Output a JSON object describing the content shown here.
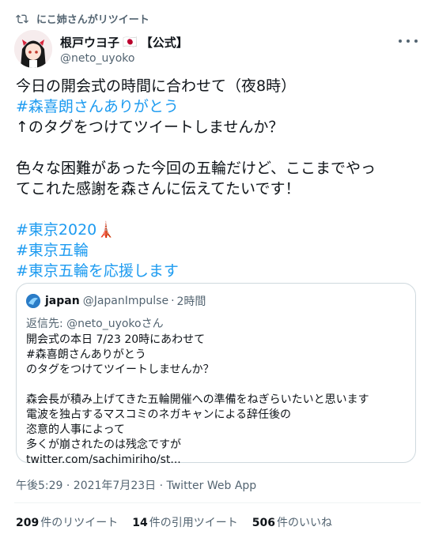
{
  "retweet_banner": "にこ姉さんがリツイート",
  "author": {
    "name": "根戸ウヨ子",
    "flag": "🇯🇵",
    "badge": "【公式】",
    "handle": "@neto_uyoko"
  },
  "tweet": {
    "line1": "今日の開会式の時間に合わせて（夜8時）",
    "line2_hashtag": "#森喜朗さんありがとう",
    "line3": "↑のタグをつけてツイートしませんか？",
    "line4": "色々な困難があった今回の五輪だけど、ここまでやっ",
    "line5": "てこれた感謝を森さんに伝えてたいです！",
    "hashtag1": "#東京2020",
    "hashtag1_emoji": "🗼",
    "hashtag2": "#東京五輪",
    "hashtag3": "#東京五輪を応援します"
  },
  "quote": {
    "name": "japan",
    "handle": "@JapanImpulse",
    "sep": "·",
    "time": "2時間",
    "reply_to": "返信先: @neto_uyokoさん",
    "lines": [
      "開会式の本日 7/23 20時にあわせて",
      "#森喜朗さんありがとう",
      "のタグをつけてツイートしませんか？",
      "",
      "森会長が積み上げてきた五輪開催への準備をねぎらいたいと思います",
      "電波を独占するマスコミのネガキャンによる辞任後の",
      "恣意的人事によって",
      "多くが崩されたのは残念ですが",
      "twitter.com/sachimiriho/st..."
    ]
  },
  "timestamp": "午後5:29 · 2021年7月23日 · Twitter Web App",
  "stats": {
    "retweets_num": "209",
    "retweets_label": "件のリツイート",
    "quotes_num": "14",
    "quotes_label": "件の引用ツイート",
    "likes_num": "506",
    "likes_label": "件のいいね"
  },
  "colors": {
    "link": "#1d9bf0",
    "secondary": "#536471"
  }
}
